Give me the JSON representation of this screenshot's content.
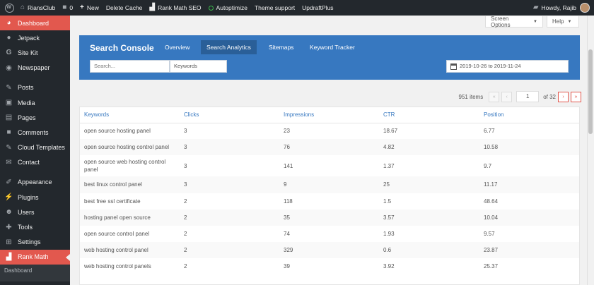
{
  "adminbar": {
    "site_name": "RiansClub",
    "comments_count": "0",
    "new_label": "New",
    "delete_cache": "Delete Cache",
    "rank_math_seo": "Rank Math SEO",
    "autoptimize": "Autoptimize",
    "theme_support": "Theme support",
    "updraftplus": "UpdraftPlus",
    "howdy": "Howdy, Rajib"
  },
  "sidebar": {
    "items": [
      {
        "label": "Dashboard",
        "icon": "dashboard-icon"
      },
      {
        "label": "Jetpack",
        "icon": "jetpack-icon"
      },
      {
        "label": "Site Kit",
        "icon": "google-icon"
      },
      {
        "label": "Newspaper",
        "icon": "eye-icon"
      },
      {
        "label": "Posts",
        "icon": "pin-icon"
      },
      {
        "label": "Media",
        "icon": "media-icon"
      },
      {
        "label": "Pages",
        "icon": "pages-icon"
      },
      {
        "label": "Comments",
        "icon": "comments-icon"
      },
      {
        "label": "Cloud Templates",
        "icon": "pin-icon"
      },
      {
        "label": "Contact",
        "icon": "mail-icon"
      },
      {
        "label": "Appearance",
        "icon": "brush-icon"
      },
      {
        "label": "Plugins",
        "icon": "plug-icon"
      },
      {
        "label": "Users",
        "icon": "users-icon"
      },
      {
        "label": "Tools",
        "icon": "wrench-icon"
      },
      {
        "label": "Settings",
        "icon": "settings-icon"
      },
      {
        "label": "Rank Math",
        "icon": "chart-icon"
      }
    ],
    "submenu_first": "Dashboard"
  },
  "screen_options": "Screen Options",
  "help": "Help",
  "search_console": {
    "title": "Search Console",
    "tabs": [
      "Overview",
      "Search Analytics",
      "Sitemaps",
      "Keyword Tracker"
    ],
    "search_placeholder": "Search...",
    "keywords_select": "Keywords",
    "date_range": "2019-10-26 to 2019-11-24"
  },
  "pagination": {
    "items": "951 items",
    "first": "«",
    "prev": "‹",
    "page": "1",
    "of": "of 32",
    "next": "›",
    "last": "»"
  },
  "table": {
    "headers": [
      "Keywords",
      "Clicks",
      "Impressions",
      "CTR",
      "Position"
    ],
    "rows": [
      [
        "open source hosting panel",
        "3",
        "23",
        "18.67",
        "6.77"
      ],
      [
        "open source hosting control panel",
        "3",
        "76",
        "4.82",
        "10.58"
      ],
      [
        "open source web hosting control panel",
        "3",
        "141",
        "1.37",
        "9.7"
      ],
      [
        "best linux control panel",
        "3",
        "9",
        "25",
        "11.17"
      ],
      [
        "best free ssl certificate",
        "2",
        "118",
        "1.5",
        "48.64"
      ],
      [
        "hosting panel open source",
        "2",
        "35",
        "3.57",
        "10.04"
      ],
      [
        "open source control panel",
        "2",
        "74",
        "1.93",
        "9.57"
      ],
      [
        "web hosting control panel",
        "2",
        "329",
        "0.6",
        "23.87"
      ],
      [
        "web hosting control panels",
        "2",
        "39",
        "3.92",
        "25.37"
      ]
    ]
  },
  "colors": {
    "accent": "#e2584e",
    "header_blue": "#3778c0",
    "adminbar": "#23282d"
  }
}
